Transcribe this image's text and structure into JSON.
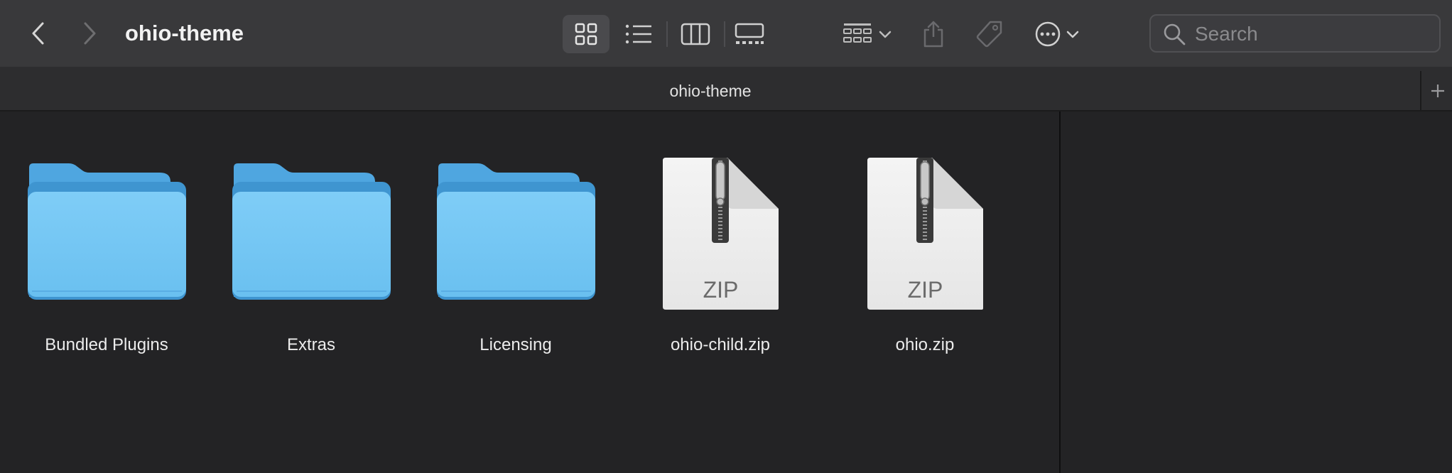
{
  "window": {
    "title": "ohio-theme"
  },
  "tab": {
    "label": "ohio-theme"
  },
  "toolbar": {
    "back_icon": "chevron-left-icon",
    "forward_icon": "chevron-right-icon",
    "views": [
      "icon-view",
      "list-view",
      "column-view",
      "gallery-view"
    ],
    "active_view": "icon-view",
    "group_icon": "group-by-icon",
    "share_icon": "share-icon",
    "tag_icon": "tag-icon",
    "more_icon": "ellipsis-circle-icon"
  },
  "search": {
    "placeholder": "Search",
    "value": ""
  },
  "new_tab_icon": "plus-icon",
  "files": [
    {
      "name": "Bundled Plugins",
      "kind": "folder"
    },
    {
      "name": "Extras",
      "kind": "folder"
    },
    {
      "name": "Licensing",
      "kind": "folder"
    },
    {
      "name": "ohio-child.zip",
      "kind": "zip",
      "badge": "ZIP"
    },
    {
      "name": "ohio.zip",
      "kind": "zip",
      "badge": "ZIP"
    }
  ],
  "colors": {
    "folder_blue": "#5ab3ec",
    "toolbar_bg": "#39393b",
    "content_bg": "#232325"
  }
}
